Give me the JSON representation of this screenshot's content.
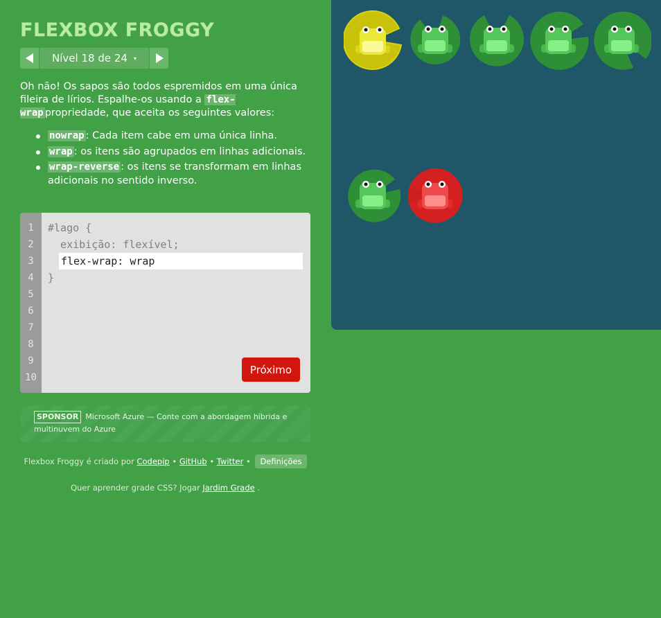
{
  "title": "FLEXBOX FROGGY",
  "level_nav": {
    "label": "Nível 18 de 24",
    "caret": "▾"
  },
  "instructions": {
    "intro_1": "Oh não! Os sapos são todos espremidos em uma única fileira de lírios. Espalhe-os usando a ",
    "intro_code": "flex-wrap",
    "intro_2": "propriedade, que aceita os seguintes valores:",
    "options": [
      {
        "code": "nowrap",
        "text": ": Cada item cabe em uma única linha."
      },
      {
        "code": "wrap",
        "text": ": os itens são agrupados em linhas adicionais."
      },
      {
        "code": "wrap-reverse",
        "text": ": os itens se transformam em linhas adicionais no sentido inverso."
      }
    ]
  },
  "editor": {
    "line_numbers": [
      "1",
      "2",
      "3",
      "4",
      "5",
      "6",
      "7",
      "8",
      "9",
      "10"
    ],
    "line_1": "#lago {",
    "line_2": "  exibição: flexível;",
    "input_value": "flex-wrap: wrap",
    "line_4": "}",
    "next_label": "Próximo"
  },
  "sponsor": {
    "badge": "SPONSOR",
    "text": "Microsoft Azure — Conte com a abordagem híbrida e multinuvem do Azure"
  },
  "credits": {
    "prefix": "Flexbox Froggy é criado por ",
    "codepip": "Codepip",
    "sep": " • ",
    "github": "GitHub",
    "twitter": "Twitter",
    "settings": "Definições"
  },
  "grid_promo": {
    "prefix": "Quer aprender grade CSS? Jogar ",
    "link": "Jardim Grade",
    "suffix": " ."
  },
  "pond": {
    "frogs": [
      {
        "color": "yellow"
      },
      {
        "color": "green"
      },
      {
        "color": "green"
      },
      {
        "color": "green"
      },
      {
        "color": "green"
      },
      {
        "color": "green"
      },
      {
        "color": "red"
      }
    ]
  },
  "colors": {
    "background": "#42a047",
    "pond": "#1f5768",
    "next_button": "#d1160f",
    "title": "#b8eda0"
  }
}
